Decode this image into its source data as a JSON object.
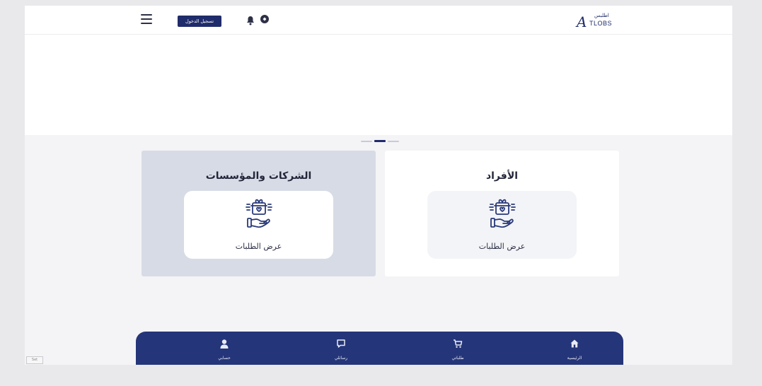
{
  "header": {
    "login_label": "تسجيل الدخول",
    "logo": {
      "mark": "A",
      "latin": "TLOBS",
      "arabic": "اطلبس"
    }
  },
  "carousel": {
    "dot_count": 3,
    "active_index": 1
  },
  "cards": [
    {
      "key": "companies",
      "title": "الشركات والمؤسسات",
      "action_label": "عرض الطلبات",
      "selected": true
    },
    {
      "key": "individuals",
      "title": "الأفراد",
      "action_label": "عرض الطلبات",
      "selected": false
    }
  ],
  "bottom_nav": {
    "items": [
      {
        "key": "account",
        "label": "حسابي",
        "icon": "user-icon"
      },
      {
        "key": "messages",
        "label": "رسائلي",
        "icon": "chat-icon"
      },
      {
        "key": "orders",
        "label": "طلباتي",
        "icon": "cart-icon"
      },
      {
        "key": "home",
        "label": "الرئيسية",
        "icon": "home-icon"
      }
    ]
  },
  "corner_tag": "Set",
  "colors": {
    "primary": "#1f2c6b",
    "nav_bg": "#253579",
    "card_selected_bg": "#d7dbe6"
  }
}
